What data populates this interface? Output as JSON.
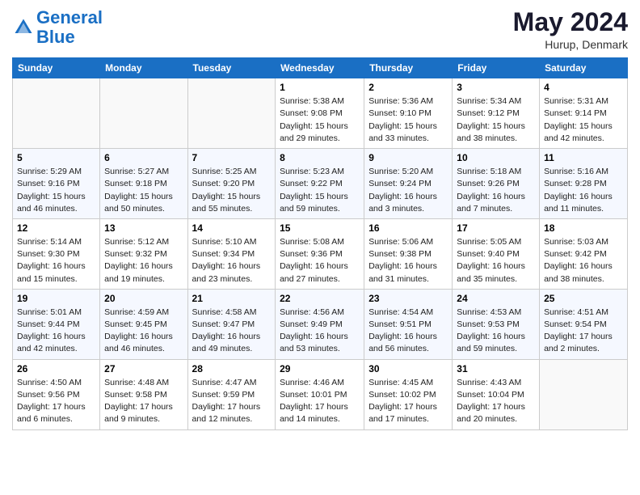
{
  "header": {
    "logo_line1": "General",
    "logo_line2": "Blue",
    "month_year": "May 2024",
    "location": "Hurup, Denmark"
  },
  "weekdays": [
    "Sunday",
    "Monday",
    "Tuesday",
    "Wednesday",
    "Thursday",
    "Friday",
    "Saturday"
  ],
  "weeks": [
    [
      {
        "day": "",
        "info": ""
      },
      {
        "day": "",
        "info": ""
      },
      {
        "day": "",
        "info": ""
      },
      {
        "day": "1",
        "info": "Sunrise: 5:38 AM\nSunset: 9:08 PM\nDaylight: 15 hours\nand 29 minutes."
      },
      {
        "day": "2",
        "info": "Sunrise: 5:36 AM\nSunset: 9:10 PM\nDaylight: 15 hours\nand 33 minutes."
      },
      {
        "day": "3",
        "info": "Sunrise: 5:34 AM\nSunset: 9:12 PM\nDaylight: 15 hours\nand 38 minutes."
      },
      {
        "day": "4",
        "info": "Sunrise: 5:31 AM\nSunset: 9:14 PM\nDaylight: 15 hours\nand 42 minutes."
      }
    ],
    [
      {
        "day": "5",
        "info": "Sunrise: 5:29 AM\nSunset: 9:16 PM\nDaylight: 15 hours\nand 46 minutes."
      },
      {
        "day": "6",
        "info": "Sunrise: 5:27 AM\nSunset: 9:18 PM\nDaylight: 15 hours\nand 50 minutes."
      },
      {
        "day": "7",
        "info": "Sunrise: 5:25 AM\nSunset: 9:20 PM\nDaylight: 15 hours\nand 55 minutes."
      },
      {
        "day": "8",
        "info": "Sunrise: 5:23 AM\nSunset: 9:22 PM\nDaylight: 15 hours\nand 59 minutes."
      },
      {
        "day": "9",
        "info": "Sunrise: 5:20 AM\nSunset: 9:24 PM\nDaylight: 16 hours\nand 3 minutes."
      },
      {
        "day": "10",
        "info": "Sunrise: 5:18 AM\nSunset: 9:26 PM\nDaylight: 16 hours\nand 7 minutes."
      },
      {
        "day": "11",
        "info": "Sunrise: 5:16 AM\nSunset: 9:28 PM\nDaylight: 16 hours\nand 11 minutes."
      }
    ],
    [
      {
        "day": "12",
        "info": "Sunrise: 5:14 AM\nSunset: 9:30 PM\nDaylight: 16 hours\nand 15 minutes."
      },
      {
        "day": "13",
        "info": "Sunrise: 5:12 AM\nSunset: 9:32 PM\nDaylight: 16 hours\nand 19 minutes."
      },
      {
        "day": "14",
        "info": "Sunrise: 5:10 AM\nSunset: 9:34 PM\nDaylight: 16 hours\nand 23 minutes."
      },
      {
        "day": "15",
        "info": "Sunrise: 5:08 AM\nSunset: 9:36 PM\nDaylight: 16 hours\nand 27 minutes."
      },
      {
        "day": "16",
        "info": "Sunrise: 5:06 AM\nSunset: 9:38 PM\nDaylight: 16 hours\nand 31 minutes."
      },
      {
        "day": "17",
        "info": "Sunrise: 5:05 AM\nSunset: 9:40 PM\nDaylight: 16 hours\nand 35 minutes."
      },
      {
        "day": "18",
        "info": "Sunrise: 5:03 AM\nSunset: 9:42 PM\nDaylight: 16 hours\nand 38 minutes."
      }
    ],
    [
      {
        "day": "19",
        "info": "Sunrise: 5:01 AM\nSunset: 9:44 PM\nDaylight: 16 hours\nand 42 minutes."
      },
      {
        "day": "20",
        "info": "Sunrise: 4:59 AM\nSunset: 9:45 PM\nDaylight: 16 hours\nand 46 minutes."
      },
      {
        "day": "21",
        "info": "Sunrise: 4:58 AM\nSunset: 9:47 PM\nDaylight: 16 hours\nand 49 minutes."
      },
      {
        "day": "22",
        "info": "Sunrise: 4:56 AM\nSunset: 9:49 PM\nDaylight: 16 hours\nand 53 minutes."
      },
      {
        "day": "23",
        "info": "Sunrise: 4:54 AM\nSunset: 9:51 PM\nDaylight: 16 hours\nand 56 minutes."
      },
      {
        "day": "24",
        "info": "Sunrise: 4:53 AM\nSunset: 9:53 PM\nDaylight: 16 hours\nand 59 minutes."
      },
      {
        "day": "25",
        "info": "Sunrise: 4:51 AM\nSunset: 9:54 PM\nDaylight: 17 hours\nand 2 minutes."
      }
    ],
    [
      {
        "day": "26",
        "info": "Sunrise: 4:50 AM\nSunset: 9:56 PM\nDaylight: 17 hours\nand 6 minutes."
      },
      {
        "day": "27",
        "info": "Sunrise: 4:48 AM\nSunset: 9:58 PM\nDaylight: 17 hours\nand 9 minutes."
      },
      {
        "day": "28",
        "info": "Sunrise: 4:47 AM\nSunset: 9:59 PM\nDaylight: 17 hours\nand 12 minutes."
      },
      {
        "day": "29",
        "info": "Sunrise: 4:46 AM\nSunset: 10:01 PM\nDaylight: 17 hours\nand 14 minutes."
      },
      {
        "day": "30",
        "info": "Sunrise: 4:45 AM\nSunset: 10:02 PM\nDaylight: 17 hours\nand 17 minutes."
      },
      {
        "day": "31",
        "info": "Sunrise: 4:43 AM\nSunset: 10:04 PM\nDaylight: 17 hours\nand 20 minutes."
      },
      {
        "day": "",
        "info": ""
      }
    ]
  ]
}
